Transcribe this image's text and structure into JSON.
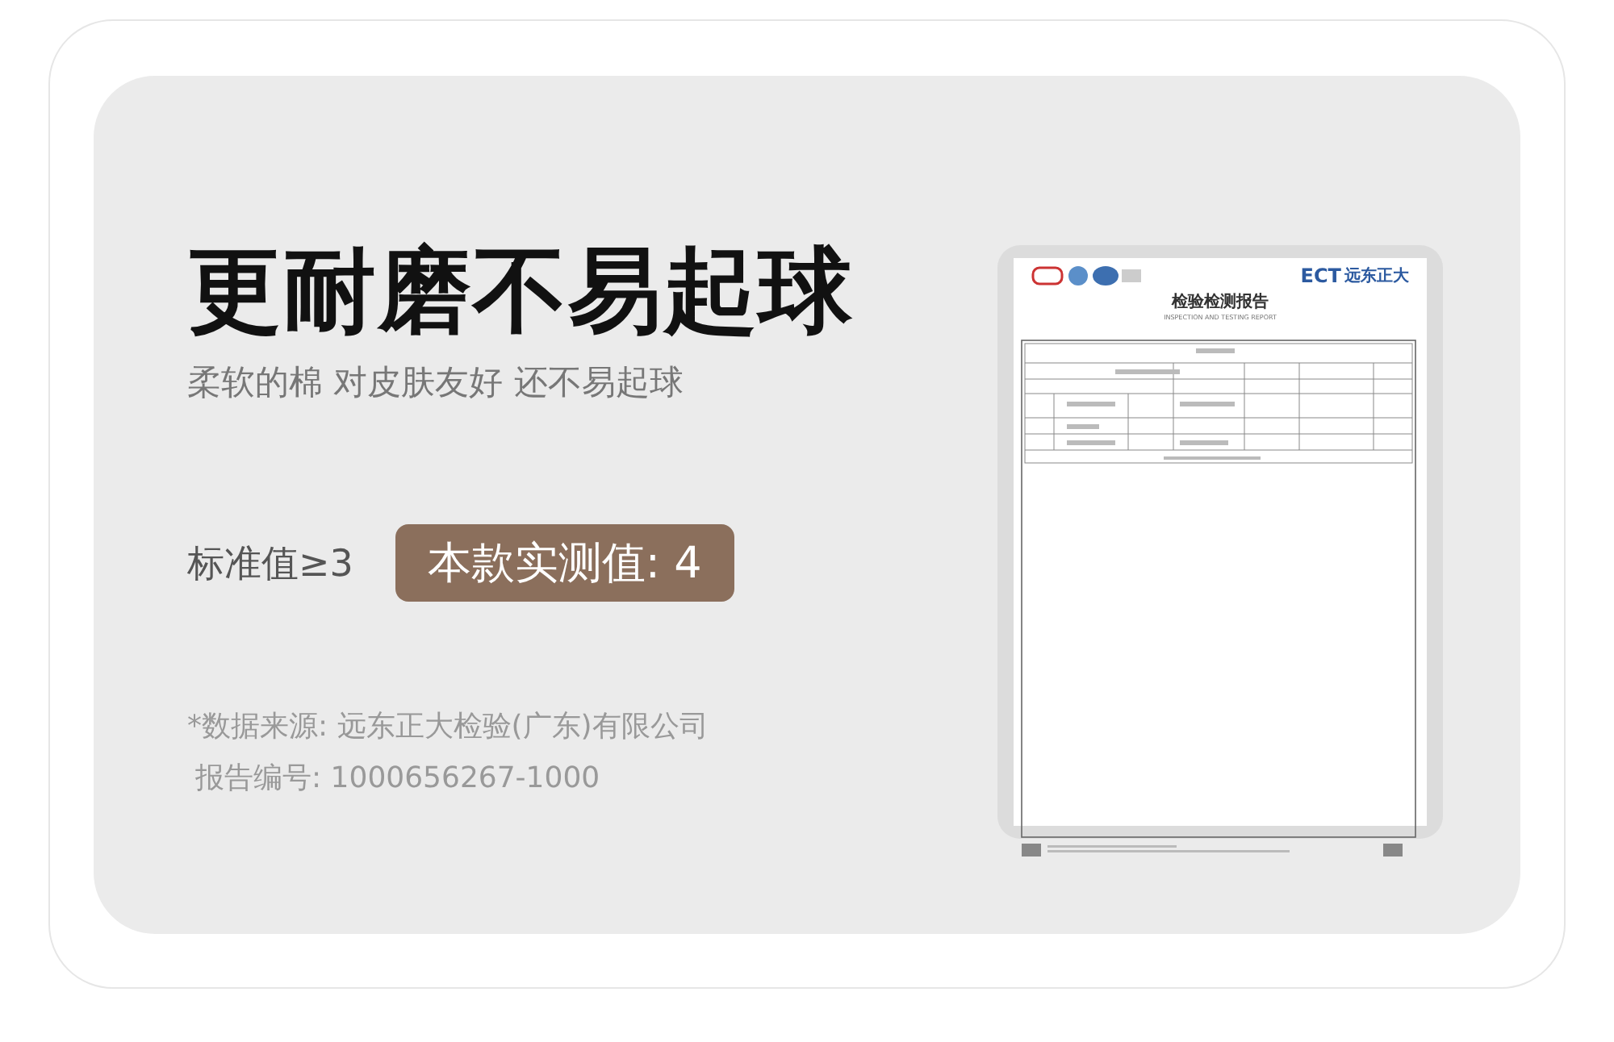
{
  "headline": "更耐磨不易起球",
  "subtitle": "柔软的棉 对皮肤友好 还不易起球",
  "standard": {
    "label": "标准值≥3",
    "measured": "本款实测值: 4"
  },
  "source": {
    "lines": [
      "*数据来源: 远东正大检验(广东)有限公司",
      "报告编号: 1000656267-1000"
    ]
  },
  "report": {
    "brand": "ECT",
    "brand_name": "远东正大",
    "title": "检验检测报告",
    "title_en": "INSPECTION AND TESTING REPORT"
  }
}
